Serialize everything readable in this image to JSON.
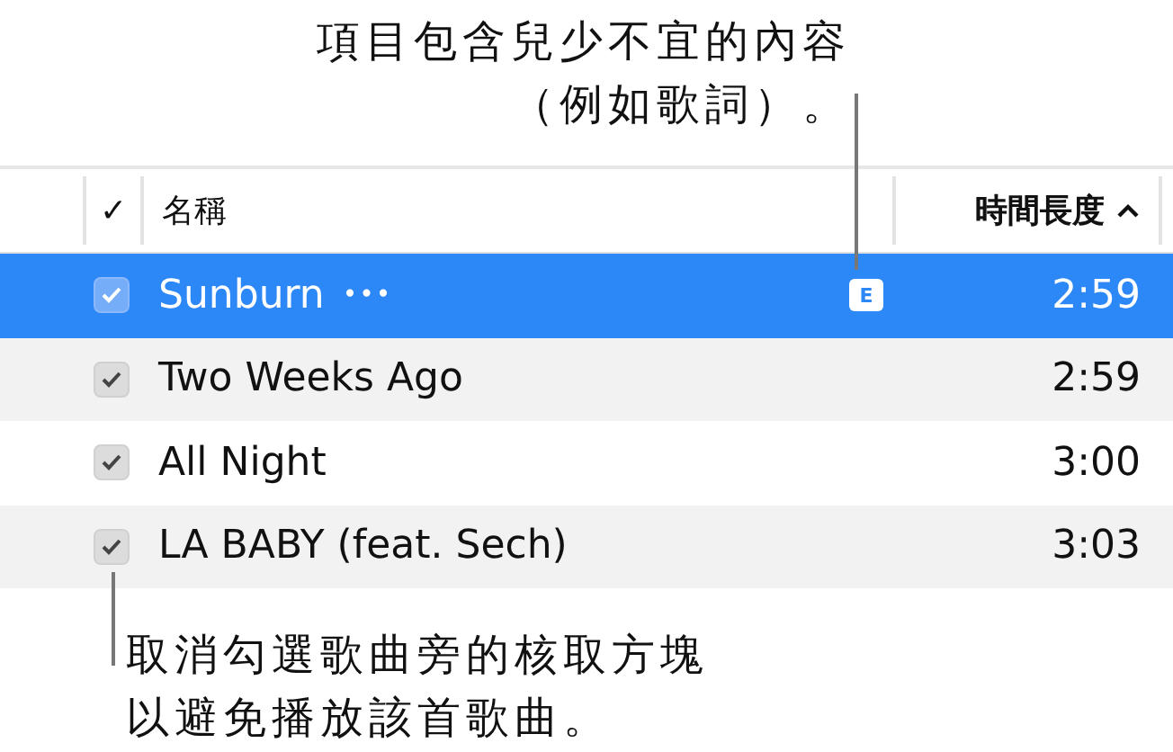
{
  "callout_top": {
    "lines": [
      "項目包含兒少不宜的內容",
      "（例如歌詞）。"
    ]
  },
  "table": {
    "columns": [
      {
        "kind": "check",
        "label": "✓"
      },
      {
        "kind": "name",
        "label": "名稱"
      },
      {
        "kind": "duration",
        "label": "時間長度"
      }
    ],
    "rows": [
      {
        "title": "Sunburn",
        "more": "•••",
        "badge": "E",
        "duration": "2:59",
        "checked": true,
        "selected": true
      },
      {
        "title": "Two Weeks Ago",
        "duration": "2:59",
        "checked": true,
        "selected": false
      },
      {
        "title": "All Night",
        "duration": "3:00",
        "checked": true,
        "selected": false
      },
      {
        "title": "LA BABY (feat. Sech)",
        "duration": "3:03",
        "checked": true,
        "selected": false
      }
    ]
  },
  "callout_bottom": {
    "lines": [
      "取消勾選歌曲旁的核取方塊",
      "以避免播放該首歌曲。"
    ]
  }
}
